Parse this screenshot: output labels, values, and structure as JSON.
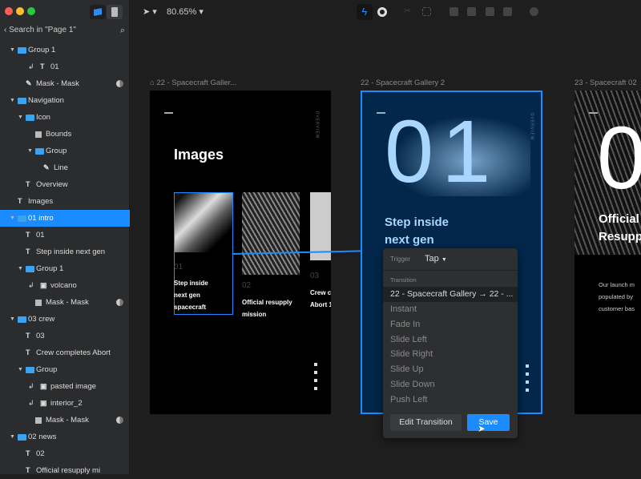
{
  "window": {
    "traffic_lights": [
      "#fe5f57",
      "#febc2e",
      "#28c840"
    ]
  },
  "sidebar": {
    "search_label": "Search in \"Page 1\"",
    "layers": [
      {
        "label": "Group 1",
        "level": 0,
        "icon": "folder-icon",
        "expanded": true
      },
      {
        "label": "01",
        "level": 2,
        "icon": "text-icon",
        "masked": true
      },
      {
        "label": "Mask - Mask",
        "level": 1,
        "icon": "mask-icon",
        "mask_badge": true
      },
      {
        "label": "Navigation",
        "level": 0,
        "icon": "folder-icon",
        "expanded": true
      },
      {
        "label": "Icon",
        "level": 1,
        "icon": "folder-icon",
        "expanded": true
      },
      {
        "label": "Bounds",
        "level": 2,
        "icon": "rectangle-icon"
      },
      {
        "label": "Group",
        "level": 2,
        "icon": "folder-icon",
        "expanded": true
      },
      {
        "label": "Line",
        "level": 3,
        "icon": "pen-icon"
      },
      {
        "label": "Overview",
        "level": 1,
        "icon": "text-icon"
      },
      {
        "label": "Images",
        "level": 0,
        "icon": "text-icon"
      },
      {
        "label": "01 intro",
        "level": 0,
        "icon": "folder-icon",
        "expanded": true,
        "selected": true
      },
      {
        "label": "01",
        "level": 1,
        "icon": "text-icon"
      },
      {
        "label": "Step inside next gen",
        "level": 1,
        "icon": "text-icon"
      },
      {
        "label": "Group 1",
        "level": 1,
        "icon": "folder-icon",
        "expanded": true
      },
      {
        "label": "volcano",
        "level": 2,
        "icon": "image-icon",
        "masked": true
      },
      {
        "label": "Mask - Mask",
        "level": 2,
        "icon": "rectangle-icon",
        "mask_badge": true
      },
      {
        "label": "03 crew",
        "level": 0,
        "icon": "folder-icon",
        "expanded": true
      },
      {
        "label": "03",
        "level": 1,
        "icon": "text-icon"
      },
      {
        "label": "Crew completes Abort",
        "level": 1,
        "icon": "text-icon"
      },
      {
        "label": "Group",
        "level": 1,
        "icon": "folder-icon",
        "expanded": true
      },
      {
        "label": "pasted image",
        "level": 2,
        "icon": "image-icon",
        "masked": true
      },
      {
        "label": "interior_2",
        "level": 2,
        "icon": "image-icon",
        "masked": true
      },
      {
        "label": "Mask - Mask",
        "level": 2,
        "icon": "rectangle-icon",
        "mask_badge": true
      },
      {
        "label": "02 news",
        "level": 0,
        "icon": "folder-icon",
        "expanded": true
      },
      {
        "label": "02",
        "level": 1,
        "icon": "text-icon"
      },
      {
        "label": "Official resupply mi",
        "level": 1,
        "icon": "text-icon"
      }
    ]
  },
  "toolbar": {
    "zoom": "80.65%",
    "accent": "#1a8cff"
  },
  "artboards": [
    {
      "title": "22 - Spacecraft Galler...",
      "heading": "Images",
      "side": "OVERVIEW",
      "cards": [
        {
          "num": "01",
          "text": "Step inside next gen spacecraft"
        },
        {
          "num": "02",
          "text": "Official resupply mission"
        },
        {
          "num": "03",
          "text": "Crew c Abort 1"
        }
      ]
    },
    {
      "title": "22 - Spacecraft Gallery 2",
      "big": "01",
      "side": "OVERVIEW",
      "heading": "Step inside next gen",
      "bg": "#02274a"
    },
    {
      "title": "23 - Spacecraft 02",
      "big": "0",
      "heading": "Official Resupp",
      "body": "Our launch m populated by customer bas"
    }
  ],
  "popup": {
    "trigger_label": "Trigger",
    "trigger_value": "Tap",
    "transition_label": "Transition",
    "selected": "22 - Spacecraft Gallery → 22 - ...",
    "options": [
      "Instant",
      "Fade In",
      "Slide Left",
      "Slide Right",
      "Slide Up",
      "Slide Down",
      "Push Left"
    ],
    "edit_button": "Edit Transition",
    "save_button": "Save"
  }
}
